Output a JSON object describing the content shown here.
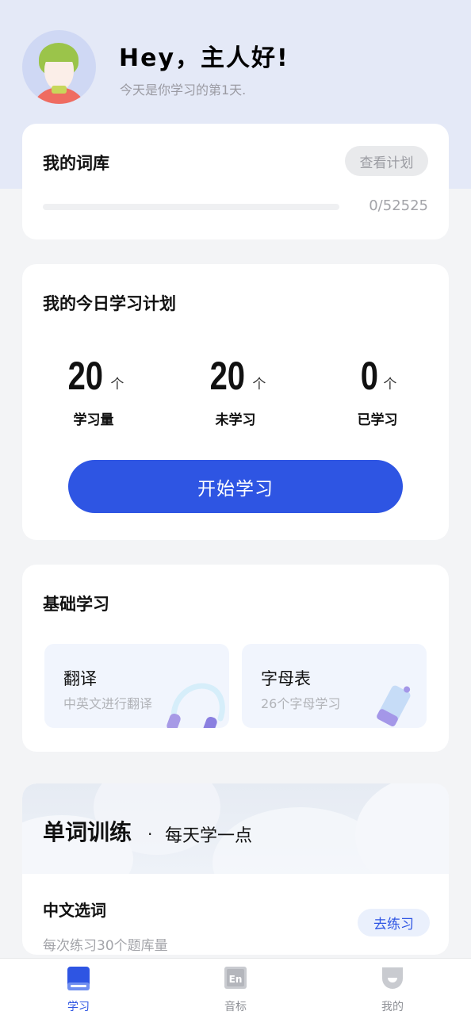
{
  "header": {
    "greeting": "Hey，主人好!",
    "subtitle": "今天是你学习的第1天."
  },
  "vocab": {
    "title": "我的词库",
    "plan_button": "查看计划",
    "progress_text": "0/52525",
    "progress_fraction": 0
  },
  "plan": {
    "title": "我的今日学习计划",
    "stats": [
      {
        "value": "20",
        "unit": "个",
        "label": "学习量"
      },
      {
        "value": "20",
        "unit": "个",
        "label": "未学习"
      },
      {
        "value": "0",
        "unit": "个",
        "label": "已学习"
      }
    ],
    "start_button": "开始学习"
  },
  "basics": {
    "title": "基础学习",
    "tiles": [
      {
        "title": "翻译",
        "subtitle": "中英文进行翻译",
        "icon": "headphones-icon"
      },
      {
        "title": "字母表",
        "subtitle": "26个字母学习",
        "icon": "eraser-icon"
      }
    ]
  },
  "training": {
    "title": "单词训练",
    "separator": "·",
    "subtitle": "每天学一点",
    "items": [
      {
        "title": "中文选词",
        "subtitle": "每次练习30个题库量",
        "button": "去练习"
      }
    ]
  },
  "tabbar": {
    "tabs": [
      {
        "label": "学习",
        "icon": "book-icon",
        "active": true
      },
      {
        "label": "音标",
        "icon": "en-phonetic-icon",
        "active": false
      },
      {
        "label": "我的",
        "icon": "profile-icon",
        "active": false
      }
    ]
  },
  "colors": {
    "accent": "#2e55e3",
    "hero_bg": "#e4e9f7",
    "page_bg": "#f3f4f6"
  }
}
